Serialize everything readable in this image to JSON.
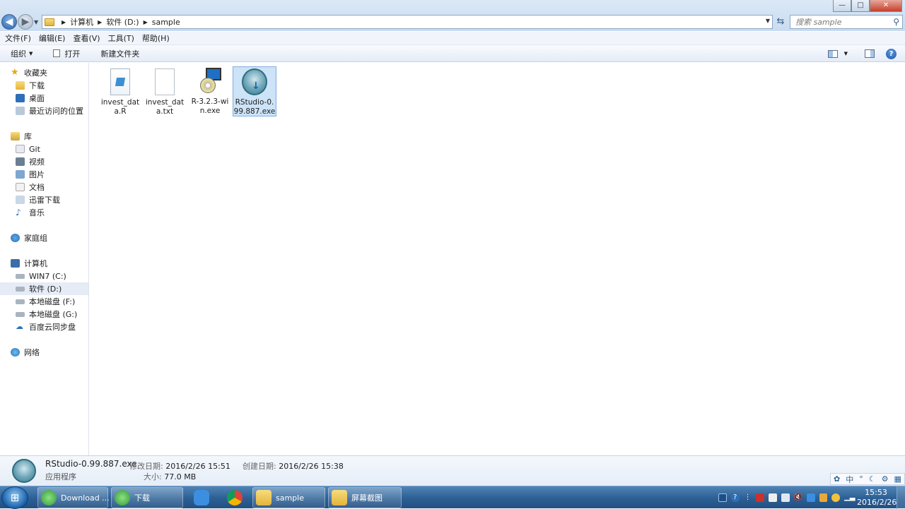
{
  "window": {
    "title_blurred": "",
    "controls": {
      "minimize": "—",
      "maximize": "□",
      "close": "✕"
    }
  },
  "address": {
    "crumbs": [
      "计算机",
      "软件 (D:)",
      "sample"
    ],
    "search_placeholder": "搜索 sample"
  },
  "menu": [
    "文件(F)",
    "编辑(E)",
    "查看(V)",
    "工具(T)",
    "帮助(H)"
  ],
  "toolbar": {
    "organize": "组织",
    "open": "打开",
    "new_folder": "新建文件夹"
  },
  "nav": {
    "favorites": {
      "label": "收藏夹",
      "items": [
        "下载",
        "桌面",
        "最近访问的位置"
      ]
    },
    "library": {
      "label": "库",
      "items": [
        "Git",
        "视频",
        "图片",
        "文档",
        "迅雷下载",
        "音乐"
      ]
    },
    "homegroup": "家庭组",
    "computer": {
      "label": "计算机",
      "items": [
        "WIN7 (C:)",
        "软件 (D:)",
        "本地磁盘 (F:)",
        "本地磁盘 (G:)",
        "百度云同步盘"
      ]
    },
    "network": "网络"
  },
  "files": [
    {
      "name_l1": "invest_dat",
      "name_l2": "a.R",
      "icon": "r-script-file-icon"
    },
    {
      "name_l1": "invest_dat",
      "name_l2": "a.txt",
      "icon": "text-file-icon"
    },
    {
      "name_l1": "R-3.2.3-wi",
      "name_l2": "n.exe",
      "icon": "r-installer-icon"
    },
    {
      "name_l1": "RStudio-0.",
      "name_l2": "99.887.exe",
      "icon": "rstudio-installer-icon",
      "selected": true
    }
  ],
  "details": {
    "name": "RStudio-0.99.887.exe",
    "type": "应用程序",
    "modified_label": "修改日期:",
    "modified": "2016/2/26 15:51",
    "created_label": "创建日期:",
    "created": "2016/2/26 15:38",
    "size_label": "大小:",
    "size": "77.0 MB"
  },
  "ime": {
    "mode": "中"
  },
  "taskbar": {
    "items": [
      {
        "label": "Download ...",
        "icon": "browser-download-icon"
      },
      {
        "label": "下载",
        "icon": "browser-download-icon"
      },
      {
        "label": "",
        "icon": "pen-app-icon"
      },
      {
        "label": "",
        "icon": "chrome-icon"
      },
      {
        "label": "sample",
        "icon": "folder-icon"
      },
      {
        "label": "屏幕截图",
        "icon": "folder-icon"
      }
    ],
    "time": "15:53",
    "date": "2016/2/26"
  },
  "colors": {
    "selection": "#cce3f8",
    "taskbar": "#2c5f94",
    "accent": "#1f6fc5"
  }
}
